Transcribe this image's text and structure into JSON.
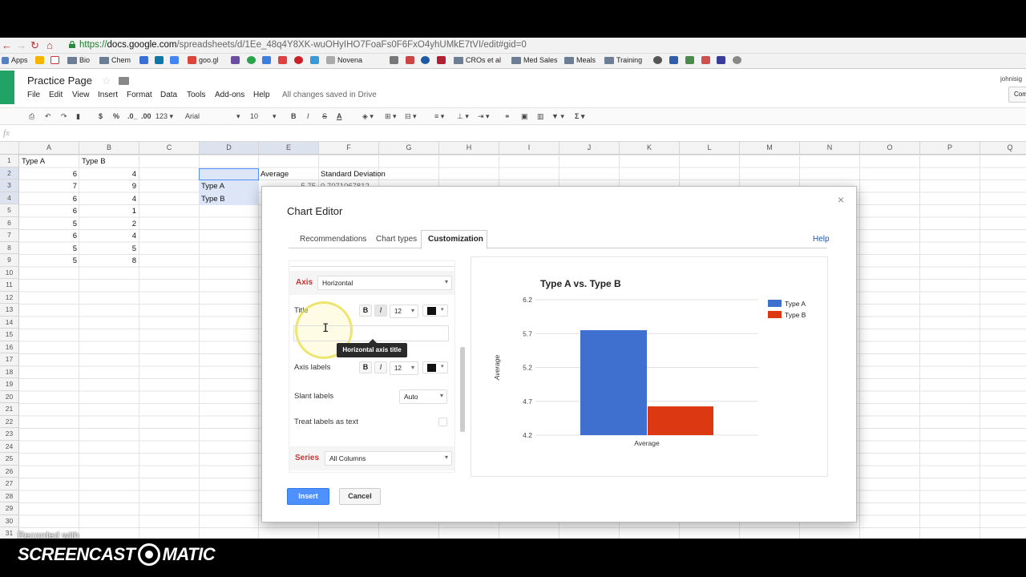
{
  "browser": {
    "url_scheme": "https://",
    "url_host": "docs.google.com",
    "url_path": "/spreadsheets/d/1Ee_48q4Y8XK-wuOHyIHO7FoaFs0F6FxO4yhUMkE7tVI/edit#gid=0",
    "bookmarks": [
      "Apps",
      "Bio",
      "Chem",
      "goo.gl",
      "Novena",
      "CROs et al",
      "Med Sales",
      "Meals",
      "Training"
    ]
  },
  "app": {
    "doc_title": "Practice Page",
    "menus": [
      "File",
      "Edit",
      "View",
      "Insert",
      "Format",
      "Data",
      "Tools",
      "Add-ons",
      "Help"
    ],
    "save_status": "All changes saved in Drive",
    "user": "johnisig",
    "comments_button": "Com"
  },
  "toolbar": {
    "currency": "$",
    "percent": "%",
    "dec_less": ".0_",
    "dec_more": ".00",
    "number_format": "123",
    "font": "Arial",
    "font_size": "10",
    "bold": "B",
    "italic": "I",
    "strike": "S",
    "text_color": "A",
    "sigma": "Σ"
  },
  "formula_bar": {
    "label": "fx"
  },
  "sheet": {
    "columns": [
      "A",
      "B",
      "C",
      "D",
      "E",
      "F",
      "G",
      "H",
      "I",
      "J",
      "K",
      "L",
      "M",
      "N",
      "O",
      "P",
      "Q"
    ],
    "rows": [
      "1",
      "2",
      "3",
      "4",
      "5",
      "6",
      "7",
      "8",
      "9",
      "10",
      "11",
      "12",
      "13",
      "14",
      "15",
      "16",
      "17",
      "18",
      "19",
      "20",
      "21",
      "22",
      "23",
      "24",
      "25",
      "26",
      "27",
      "28",
      "29",
      "30",
      "31"
    ],
    "a1": "Type A",
    "b1": "Type B",
    "col_a": [
      "6",
      "7",
      "6",
      "6",
      "5",
      "6",
      "5",
      "5"
    ],
    "col_b": [
      "4",
      "9",
      "4",
      "1",
      "2",
      "4",
      "5",
      "8"
    ],
    "e2": "Average",
    "f2": "Standard Deviation",
    "d3": "Type A",
    "d4": "Type B",
    "e3_partial": "5.75",
    "f3_partial": "0.7071067812"
  },
  "dialog": {
    "title": "Chart Editor",
    "close": "×",
    "tabs": [
      "Recommendations",
      "Chart types",
      "Customization"
    ],
    "active_tab": "Customization",
    "help": "Help",
    "axis_label": "Axis",
    "axis_select": "Horizontal",
    "title_label": "Title",
    "title_font_size": "12",
    "tooltip": "Horizontal axis title",
    "axis_labels_label": "Axis labels",
    "axis_labels_font_size": "12",
    "slant_label": "Slant labels",
    "slant_value": "Auto",
    "treat_label": "Treat labels as text",
    "series_label": "Series",
    "series_select": "All Columns",
    "insert": "Insert",
    "cancel": "Cancel"
  },
  "chart_data": {
    "type": "bar",
    "title": "Type A vs. Type B",
    "xlabel": "",
    "ylabel": "Average",
    "categories": [
      "Average"
    ],
    "series": [
      {
        "name": "Type A",
        "values": [
          5.75
        ],
        "color": "#3f6fcf"
      },
      {
        "name": "Type B",
        "values": [
          4.625
        ],
        "color": "#dc3912"
      }
    ],
    "ylim": [
      4.2,
      6.2
    ],
    "yticks": [
      "6.2",
      "5.7",
      "5.2",
      "4.7",
      "4.2"
    ],
    "legend": "right"
  },
  "recorder": {
    "recorded_with": "Recorded with",
    "brand_left": "SCREENCAST",
    "brand_right": "MATIC"
  }
}
